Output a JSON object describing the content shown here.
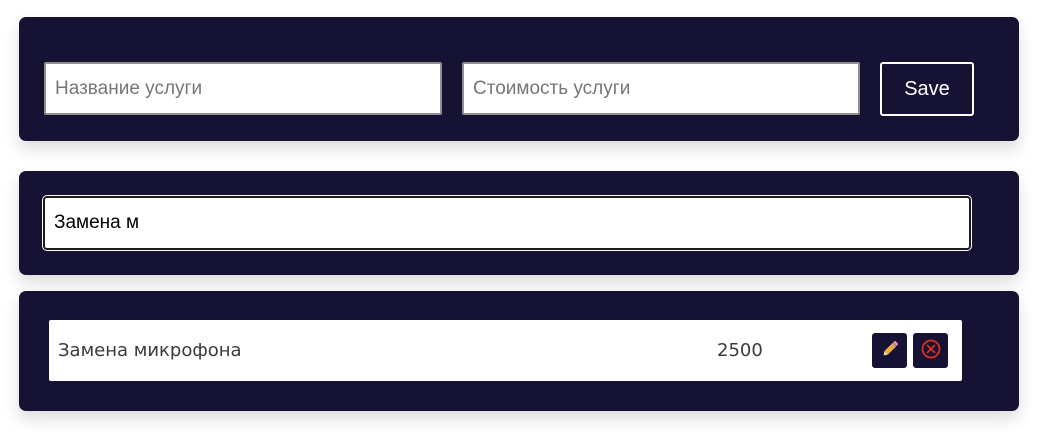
{
  "form": {
    "name_placeholder": "Название услуги",
    "name_value": "",
    "cost_placeholder": "Стоимость услуги",
    "cost_value": "",
    "save_label": "Save"
  },
  "search": {
    "value": "Замена м"
  },
  "services": [
    {
      "name": "Замена микрофона",
      "price": "2500",
      "edit_icon": "pencil-icon",
      "delete_icon": "circle-x-icon"
    }
  ],
  "colors": {
    "panel_bg": "#161233",
    "save_border": "#ffffff",
    "pencil": "#f2a93b",
    "delete": "#e0301e"
  }
}
